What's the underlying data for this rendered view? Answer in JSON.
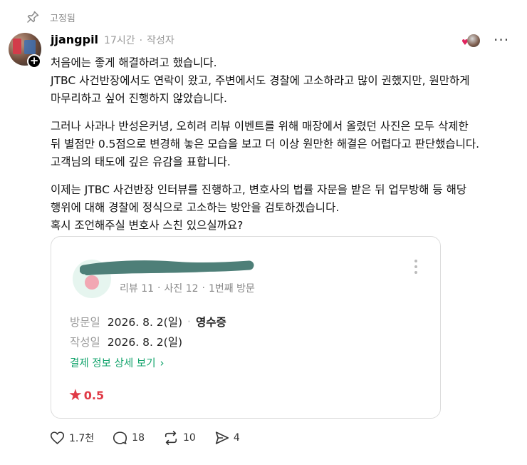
{
  "pinned": {
    "label": "고정됨",
    "icon": "pin-icon"
  },
  "post": {
    "username": "jjangpil",
    "time": "17시간",
    "author_tag": "작성자",
    "paragraphs": [
      [
        "처음에는 좋게 해결하려고 했습니다.",
        "JTBC 사건반장에서도 연락이 왔고, 주변에서도 경찰에 고소하라고 많이 권했지만, 원만하게",
        "마무리하고 싶어 진행하지 않았습니다."
      ],
      [
        "그러나 사과나 반성은커녕, 오히려 리뷰 이벤트를 위해 매장에서 올렸던 사진은 모두 삭제한",
        "뒤 별점만 0.5점으로 변경해 놓은 모습을 보고 더 이상 원만한 해결은 어렵다고 판단했습니다.",
        "고객님의 태도에 깊은 유감을 표합니다."
      ],
      [
        "이제는 JTBC 사건반장 인터뷰를 진행하고, 변호사의 법률 자문을 받은 뒤 업무방해 등 해당",
        "행위에 대해 경찰에 정식으로 고소하는 방안을 검토하겠습니다.",
        "혹시 조언해주실 변호사 스친 있으실까요?"
      ]
    ]
  },
  "review_card": {
    "reviewer_name": "",
    "reviews": "리뷰 11",
    "photos": "사진 12",
    "visit_count": "1번째 방문",
    "visit_label": "방문일",
    "visit_date": "2026. 8. 2(일)",
    "receipt": "영수증",
    "written_label": "작성일",
    "written_date": "2026. 8. 2(일)",
    "payment_link": "결제 정보 상세 보기",
    "rating": "0.5",
    "accent_green": "#11a36b",
    "accent_red": "#e03a46"
  },
  "actions": {
    "likes": "1.7천",
    "comments": "18",
    "reposts": "10",
    "shares": "4"
  }
}
